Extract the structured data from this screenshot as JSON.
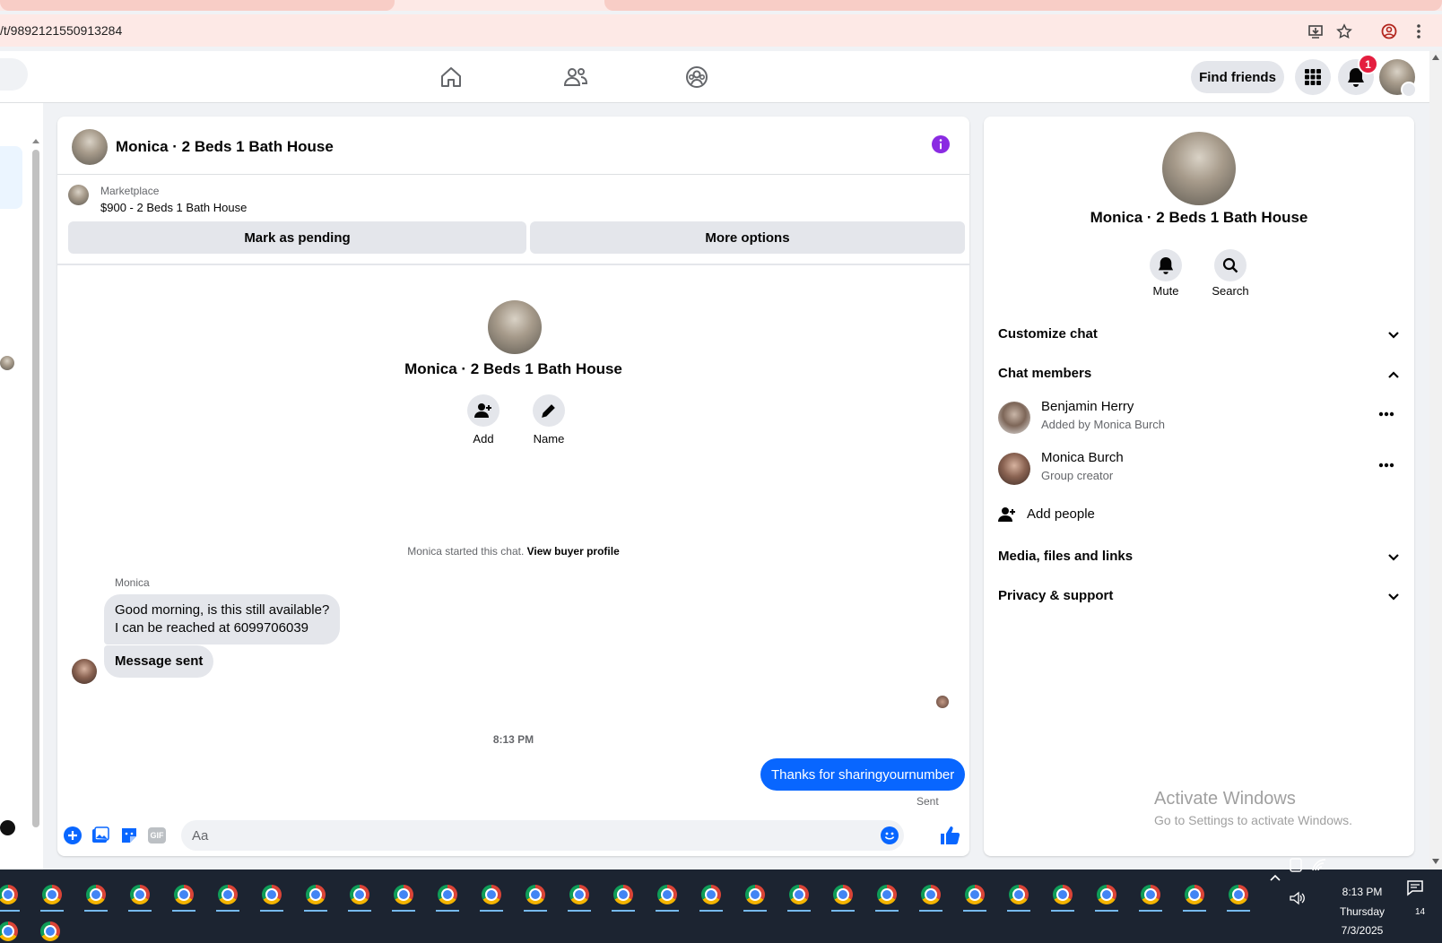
{
  "browser": {
    "url": "/t/9892121550913284"
  },
  "topnav": {
    "find_friends": "Find friends",
    "notification_count": "1"
  },
  "chat": {
    "title": "Monica · 2 Beds 1 Bath House",
    "marketplace_label": "Marketplace",
    "listing": "$900 - 2 Beds 1 Bath House",
    "mark_pending": "Mark as pending",
    "more_options": "More options",
    "profile_name": "Monica · 2 Beds 1 Bath House",
    "add_label": "Add",
    "name_label": "Name",
    "started_text": "Monica started this chat.",
    "view_buyer": "View buyer profile",
    "sender": "Monica",
    "msg1_line1": "Good morning, is this still available?",
    "msg1_line2": "I can be reached at 6099706039",
    "msg2": "Message sent",
    "timestamp": "8:13 PM",
    "my_msg": "Thanks for sharingyournumber",
    "sent_status": "Sent",
    "input_placeholder": "Aa",
    "accent": "#0866ff"
  },
  "info": {
    "title": "Monica · 2 Beds 1 Bath House",
    "mute": "Mute",
    "search": "Search",
    "customize": "Customize chat",
    "members": "Chat members",
    "member1_name": "Benjamin Herry",
    "member1_sub": "Added by Monica Burch",
    "member2_name": "Monica Burch",
    "member2_sub": "Group creator",
    "add_people": "Add people",
    "media": "Media, files and links",
    "privacy": "Privacy & support"
  },
  "watermark": {
    "line1": "Activate Windows",
    "line2": "Go to Settings to activate Windows."
  },
  "taskbar": {
    "time": "8:13 PM",
    "day": "Thursday",
    "date": "7/3/2025",
    "notif_count": "14"
  }
}
